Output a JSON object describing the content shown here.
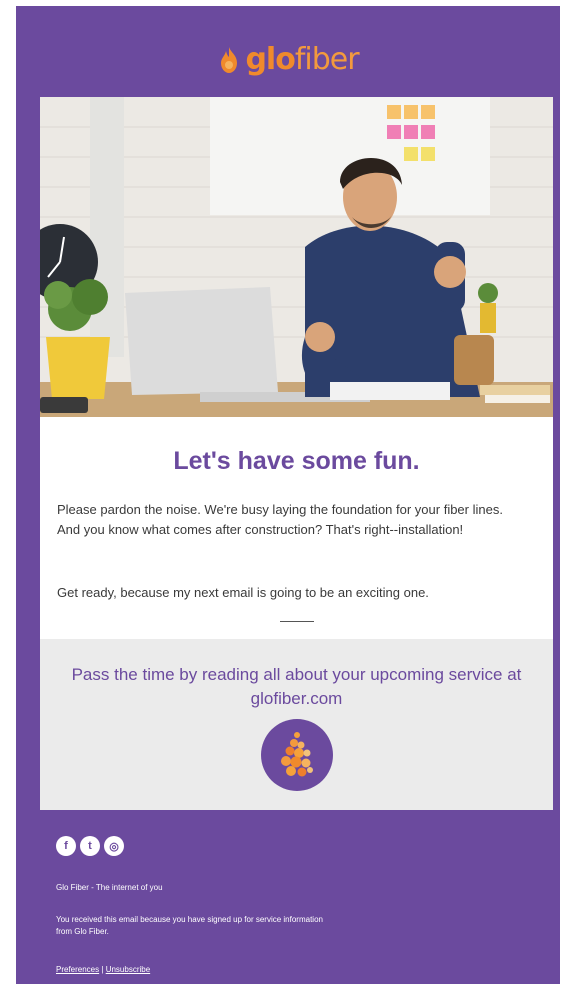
{
  "brand": {
    "logo_part1": "glo",
    "logo_part2": "fiber",
    "purple": "#6b4a9e",
    "orange": "#f08a2c"
  },
  "hero": {
    "image_icon": "celebrating-man-laptop-photo"
  },
  "main": {
    "headline": "Let's have some fun.",
    "paragraph1": "Please pardon the noise. We're busy laying the foundation for your fiber lines. And you know what comes after construction? That's right--installation!",
    "paragraph2": "Get ready, because my next email is going to be an exciting one."
  },
  "cta": {
    "text": "Pass the time by reading all about your upcoming service at",
    "link": "glofiber.com",
    "icon": "flame-icon"
  },
  "footer": {
    "social": [
      {
        "name": "facebook-icon",
        "glyph": "f"
      },
      {
        "name": "twitter-icon",
        "glyph": "t"
      },
      {
        "name": "instagram-icon",
        "glyph": "◎"
      }
    ],
    "tagline": "Glo Fiber - The internet of you",
    "notice": "You received this email because you have signed up for service information from Glo Fiber.",
    "preferences": "Preferences",
    "separator": "|",
    "unsubscribe": "Unsubscribe"
  }
}
